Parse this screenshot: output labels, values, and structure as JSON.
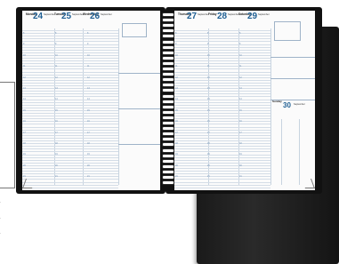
{
  "planner": {
    "left_page": {
      "days": [
        {
          "name": "Monday",
          "num": "24",
          "month": "September"
        },
        {
          "name": "Tuesday",
          "num": "25",
          "month": "September"
        },
        {
          "name": "Wednesday",
          "num": "26",
          "month": "September"
        }
      ]
    },
    "right_page": {
      "days": [
        {
          "name": "Thursday",
          "num": "27",
          "month": "September"
        },
        {
          "name": "Friday",
          "num": "28",
          "month": "September"
        },
        {
          "name": "Saturday",
          "num": "29",
          "month": "September"
        }
      ],
      "sunday": {
        "name": "Sunday",
        "num": "30",
        "month": "September"
      }
    },
    "hours": [
      "8",
      "9",
      "10",
      "11",
      "12",
      "13",
      "14",
      "15",
      "16",
      "17",
      "18",
      "19",
      "20",
      "21"
    ],
    "colors": {
      "accent": "#1f5f93",
      "gridline": "#d4dde7",
      "cover": "#111111"
    }
  }
}
